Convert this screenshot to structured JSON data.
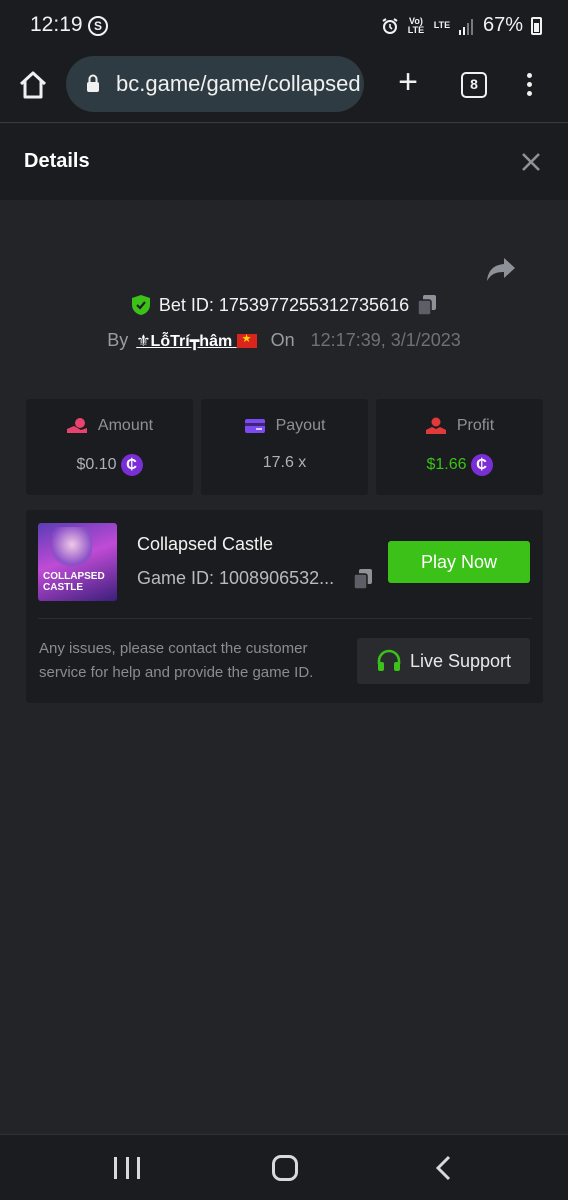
{
  "status_bar": {
    "time": "12:19",
    "app_badge": "S",
    "network_1": "Vo) LTE",
    "network_2": "LTE",
    "battery": "67%"
  },
  "browser": {
    "url": "bc.game/game/collapsed",
    "tab_count": "8"
  },
  "dialog": {
    "title": "Details"
  },
  "bet": {
    "bet_id": "Bet ID: 1753977255312735616",
    "by_label": "By",
    "user": "⚜LỗTrí┳hâm",
    "on_label": "On",
    "datetime": "12:17:39, 3/1/2023"
  },
  "stats": [
    {
      "label": "Amount",
      "value": "$0.10",
      "icon": "coin-hand-icon",
      "has_coin": true
    },
    {
      "label": "Payout",
      "value": "17.6 x",
      "icon": "card-icon",
      "has_coin": false
    },
    {
      "label": "Profit",
      "value": "$1.66",
      "icon": "profit-hand-icon",
      "has_coin": true
    }
  ],
  "game": {
    "name": "Collapsed Castle",
    "game_id": "Game ID: 1008906532...",
    "thumb_text_1": "COLLAPSED",
    "thumb_text_2": "CASTLE",
    "play_label": "Play Now",
    "issues_text": "Any issues, please contact the customer service for help and provide the game ID.",
    "support_label": "Live Support"
  },
  "colors": {
    "accent_green": "#3bc117",
    "coin_purple": "#7a2fd6",
    "amount_pink": "#e8436f",
    "payout_purple": "#7b4bf0",
    "profit_red": "#e23a3a"
  }
}
